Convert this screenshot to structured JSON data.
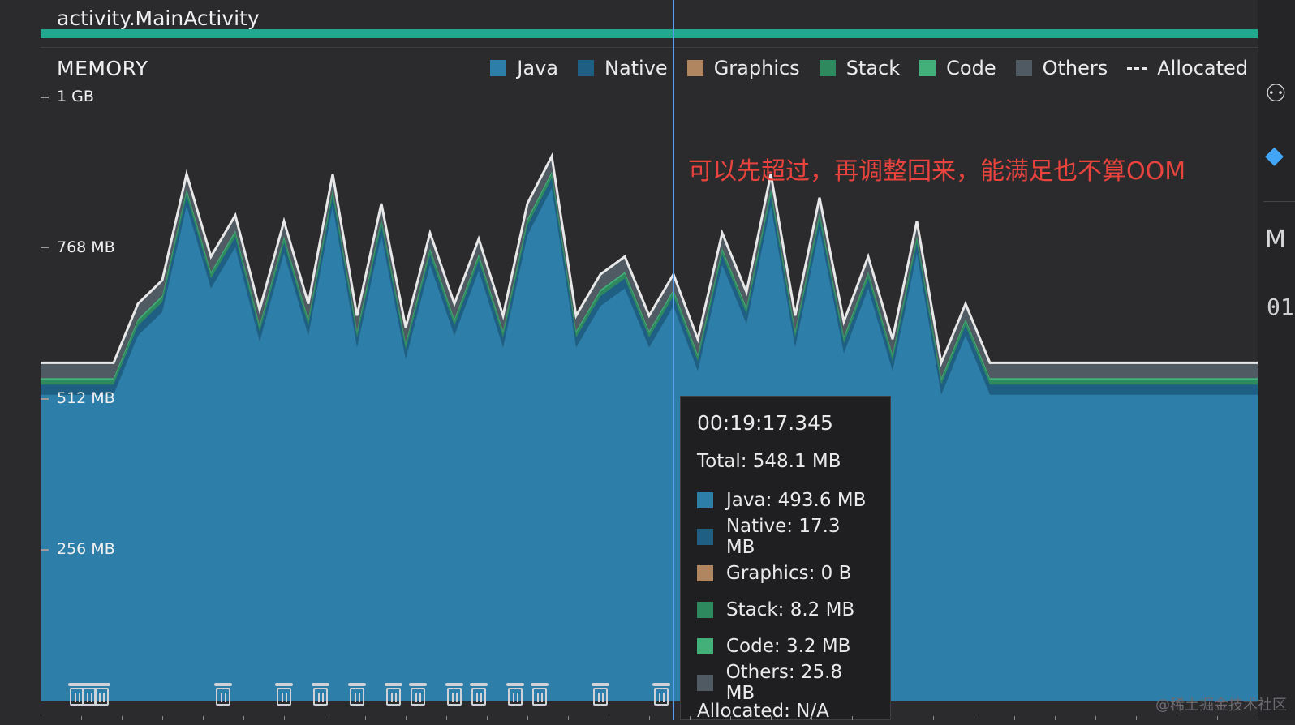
{
  "header": {
    "activity_label": "activity.MainActivity"
  },
  "monitor": {
    "title": "MEMORY"
  },
  "legend": [
    {
      "label": "Java",
      "color": "#2d7ea8",
      "kind": "swatch"
    },
    {
      "label": "Native",
      "color": "#1f5f83",
      "kind": "swatch"
    },
    {
      "label": "Graphics",
      "color": "#b08660",
      "kind": "swatch"
    },
    {
      "label": "Stack",
      "color": "#2e8a5e",
      "kind": "swatch"
    },
    {
      "label": "Code",
      "color": "#43b07a",
      "kind": "swatch"
    },
    {
      "label": "Others",
      "color": "#4f5a62",
      "kind": "swatch"
    },
    {
      "label": "Allocated",
      "color": "#e8e8e8",
      "kind": "dash"
    }
  ],
  "annotation": "可以先超过，再调整回来，能满足也不算OOM",
  "tooltip": {
    "time": "00:19:17.345",
    "total": "Total: 548.1 MB",
    "rows": [
      {
        "label": "Java: 493.6 MB",
        "color": "#2d7ea8"
      },
      {
        "label": "Native: 17.3 MB",
        "color": "#1f5f83"
      },
      {
        "label": "Graphics: 0 B",
        "color": "#b08660"
      },
      {
        "label": "Stack: 8.2 MB",
        "color": "#2e8a5e"
      },
      {
        "label": "Code: 3.2 MB",
        "color": "#43b07a"
      },
      {
        "label": "Others: 25.8 MB",
        "color": "#4f5a62"
      }
    ],
    "allocated": "Allocated: N/A"
  },
  "watermark": "@稀土掘金技术社区",
  "right_panel": {
    "icons": [
      "profiler-icon",
      "flutter-icon",
      "memory-m-icon"
    ],
    "text": "01"
  },
  "chart_data": {
    "type": "area",
    "title": "MEMORY",
    "ylabel": "",
    "y_unit": "MB",
    "ylim": [
      0,
      1024
    ],
    "y_ticks": [
      {
        "value": 256,
        "label": "256 MB"
      },
      {
        "value": 512,
        "label": "512 MB"
      },
      {
        "value": 768,
        "label": "768 MB"
      },
      {
        "value": 1024,
        "label": "1 GB"
      }
    ],
    "x": [
      0,
      2,
      4,
      6,
      8,
      10,
      12,
      14,
      16,
      18,
      20,
      22,
      24,
      26,
      28,
      30,
      32,
      34,
      36,
      38,
      40,
      42,
      44,
      46,
      48,
      50,
      52,
      54,
      56,
      58,
      60,
      62,
      64,
      66,
      68,
      70,
      72,
      74,
      76,
      78,
      80,
      82,
      84,
      86,
      88,
      90,
      92,
      94,
      96,
      98,
      100
    ],
    "series": [
      {
        "name": "Java",
        "color": "#2d7ea8",
        "values": [
          520,
          520,
          520,
          520,
          620,
          660,
          840,
          700,
          770,
          610,
          760,
          620,
          840,
          600,
          790,
          580,
          740,
          620,
          730,
          600,
          790,
          870,
          600,
          670,
          700,
          600,
          670,
          560,
          740,
          640,
          840,
          600,
          800,
          590,
          700,
          560,
          760,
          520,
          620,
          520,
          520,
          520,
          520,
          520,
          520,
          520,
          520,
          520,
          520,
          520,
          520
        ]
      },
      {
        "name": "Native",
        "color": "#1f5f83",
        "values": [
          17,
          17,
          17,
          17,
          17,
          17,
          17,
          17,
          17,
          17,
          17,
          17,
          17,
          17,
          17,
          17,
          17,
          17,
          17,
          17,
          17,
          17,
          17,
          17,
          17,
          17,
          17,
          17,
          17,
          17,
          17,
          17,
          17,
          17,
          17,
          17,
          17,
          17,
          17,
          17,
          17,
          17,
          17,
          17,
          17,
          17,
          17,
          17,
          17,
          17,
          17
        ]
      },
      {
        "name": "Stack",
        "color": "#2e8a5e",
        "values": [
          8,
          8,
          8,
          8,
          8,
          8,
          8,
          8,
          8,
          8,
          8,
          8,
          8,
          8,
          8,
          8,
          8,
          8,
          8,
          8,
          8,
          8,
          8,
          8,
          8,
          8,
          8,
          8,
          8,
          8,
          8,
          8,
          8,
          8,
          8,
          8,
          8,
          8,
          8,
          8,
          8,
          8,
          8,
          8,
          8,
          8,
          8,
          8,
          8,
          8,
          8
        ]
      },
      {
        "name": "Code",
        "color": "#43b07a",
        "values": [
          3,
          3,
          3,
          3,
          3,
          3,
          3,
          3,
          3,
          3,
          3,
          3,
          3,
          3,
          3,
          3,
          3,
          3,
          3,
          3,
          3,
          3,
          3,
          3,
          3,
          3,
          3,
          3,
          3,
          3,
          3,
          3,
          3,
          3,
          3,
          3,
          3,
          3,
          3,
          3,
          3,
          3,
          3,
          3,
          3,
          3,
          3,
          3,
          3,
          3,
          3
        ]
      },
      {
        "name": "Others",
        "color": "#4f5a62",
        "values": [
          26,
          26,
          26,
          26,
          26,
          26,
          26,
          26,
          26,
          26,
          26,
          26,
          26,
          26,
          26,
          26,
          26,
          26,
          26,
          26,
          26,
          26,
          26,
          26,
          26,
          26,
          26,
          26,
          26,
          26,
          26,
          26,
          26,
          26,
          26,
          26,
          26,
          26,
          26,
          26,
          26,
          26,
          26,
          26,
          26,
          26,
          26,
          26,
          26,
          26,
          26
        ]
      }
    ],
    "cursor_x": 52,
    "gc_events_x": [
      3,
      4,
      5,
      15,
      20,
      23,
      26,
      29,
      31,
      34,
      36,
      39,
      41,
      46,
      51
    ]
  }
}
